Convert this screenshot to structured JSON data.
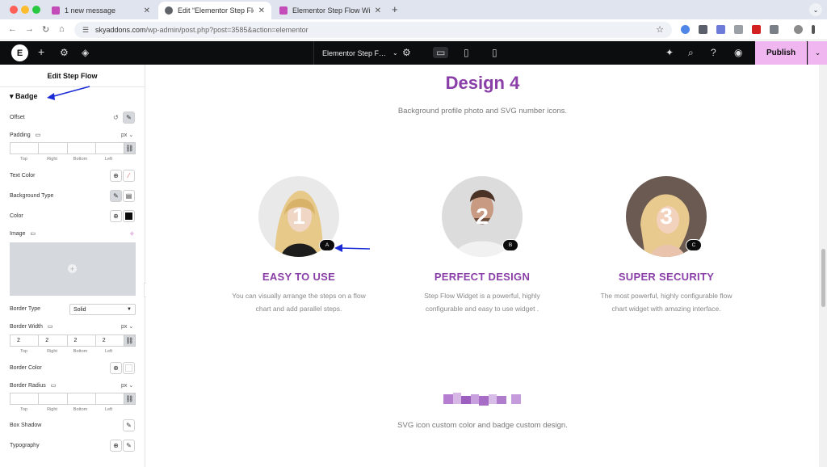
{
  "browser": {
    "tabs": [
      {
        "label": "1 new message",
        "fav_color": "#c44cb8"
      },
      {
        "label": "Edit “Elementor Step Flow W…",
        "fav_color": "#5f6368"
      },
      {
        "label": "Elementor Step Flow Widget…",
        "fav_color": "#c44cb8"
      }
    ],
    "url_host": "skyaddons.com",
    "url_path": "/wp-admin/post.php?post=3585&action=elementor"
  },
  "editor": {
    "doc_title": "Elementor Step F…",
    "publish_label": "Publish"
  },
  "panel": {
    "title": "Edit Step Flow",
    "section": "Badge",
    "offset_label": "Offset",
    "padding_label": "Padding",
    "unit": "px",
    "dim_labels": [
      "Top",
      "Right",
      "Bottom",
      "Left"
    ],
    "text_color_label": "Text Color",
    "bg_type_label": "Background Type",
    "color_label": "Color",
    "image_label": "Image",
    "border_type_label": "Border Type",
    "border_type_value": "Solid",
    "border_width_label": "Border Width",
    "border_width_values": [
      "2",
      "2",
      "2",
      "2"
    ],
    "border_color_label": "Border Color",
    "border_radius_label": "Border Radius",
    "box_shadow_label": "Box Shadow",
    "typography_label": "Typography"
  },
  "canvas": {
    "design4_title": "Design 4",
    "design4_subtitle": "Background profile photo and SVG number icons.",
    "steps": [
      {
        "number": "1",
        "badge": "A",
        "title": "EASY TO USE",
        "desc_line1": "You can visually arrange the steps on a flow",
        "desc_line2": "chart and add parallel steps."
      },
      {
        "number": "2",
        "badge": "B",
        "title": "PERFECT DESIGN",
        "desc_line1": "Step Flow Widget is a powerful, highly",
        "desc_line2": "configurable and easy to use widget ."
      },
      {
        "number": "3",
        "badge": "C",
        "title": "SUPER SECURITY",
        "desc_line1": "The most powerful, highly configurable flow",
        "desc_line2": "chart widget with amazing interface."
      }
    ],
    "design5_subtitle": "SVG icon custom color and badge custom design."
  },
  "colors": {
    "accent": "#8a3ea8",
    "publish": "#f0b6ef",
    "annotation": "#1a2bd6"
  }
}
